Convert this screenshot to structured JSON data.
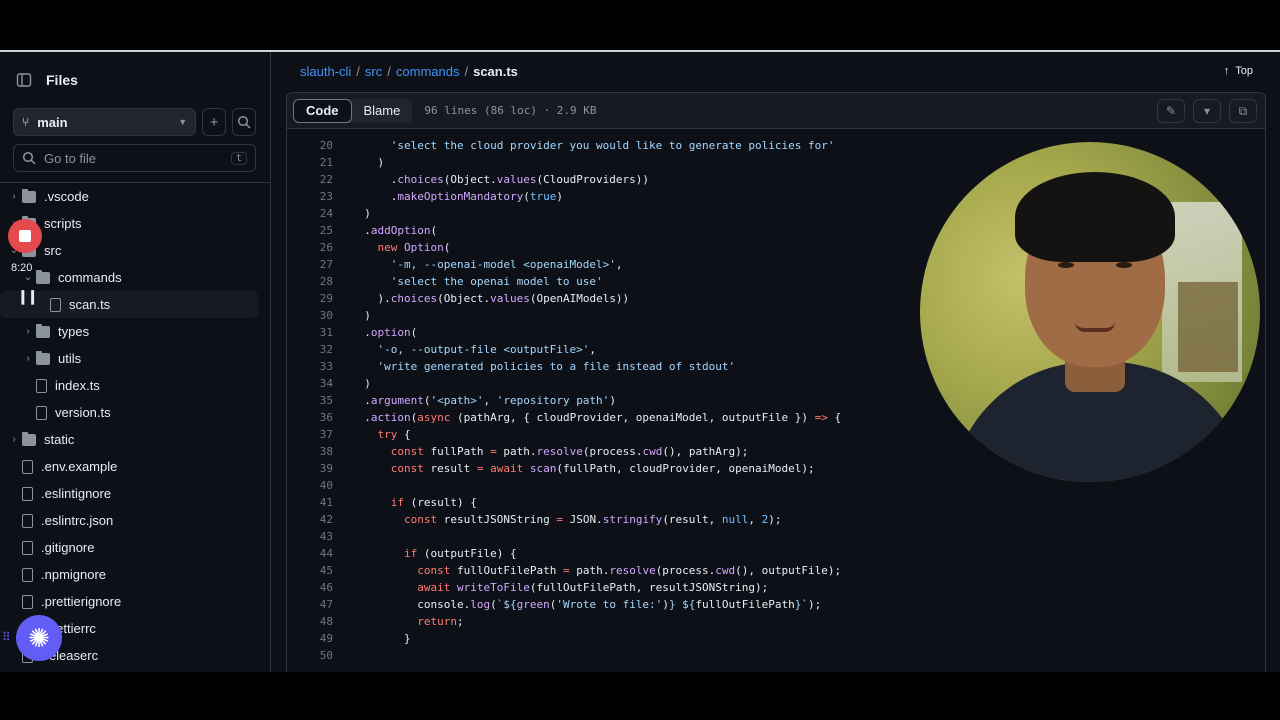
{
  "sidebar": {
    "title": "Files",
    "branch": "main",
    "search_placeholder": "Go to file",
    "search_shortcut": "t",
    "tree": [
      {
        "name": ".vscode",
        "kind": "folder",
        "chev": "›",
        "indent": 1
      },
      {
        "name": "scripts",
        "kind": "folder",
        "chev": "›",
        "indent": 1
      },
      {
        "name": "src",
        "kind": "folder",
        "chev": "⌄",
        "indent": 1
      },
      {
        "name": "commands",
        "kind": "folder",
        "chev": "⌄",
        "indent": 2
      },
      {
        "name": "scan.ts",
        "kind": "file",
        "chev": "",
        "indent": 3,
        "active": true
      },
      {
        "name": "types",
        "kind": "folder",
        "chev": "›",
        "indent": 2
      },
      {
        "name": "utils",
        "kind": "folder",
        "chev": "›",
        "indent": 2
      },
      {
        "name": "index.ts",
        "kind": "file",
        "chev": "",
        "indent": 2
      },
      {
        "name": "version.ts",
        "kind": "file",
        "chev": "",
        "indent": 2
      },
      {
        "name": "static",
        "kind": "folder",
        "chev": "›",
        "indent": 1
      },
      {
        "name": ".env.example",
        "kind": "file",
        "chev": "",
        "indent": 1
      },
      {
        "name": ".eslintignore",
        "kind": "file",
        "chev": "",
        "indent": 1
      },
      {
        "name": ".eslintrc.json",
        "kind": "file",
        "chev": "",
        "indent": 1
      },
      {
        "name": ".gitignore",
        "kind": "file",
        "chev": "",
        "indent": 1
      },
      {
        "name": ".npmignore",
        "kind": "file",
        "chev": "",
        "indent": 1
      },
      {
        "name": ".prettierignore",
        "kind": "file",
        "chev": "",
        "indent": 1
      },
      {
        "name": ".prettierrc",
        "kind": "file",
        "chev": "",
        "indent": 1
      },
      {
        "name": ".releaserc",
        "kind": "file",
        "chev": "",
        "indent": 1
      }
    ]
  },
  "recorder": {
    "time": "8:20"
  },
  "breadcrumb": {
    "repo": "slauth-cli",
    "dir1": "src",
    "dir2": "commands",
    "file": "scan.ts",
    "sep": "/"
  },
  "top_link": "Top",
  "file_header": {
    "code_tab": "Code",
    "blame_tab": "Blame",
    "meta": "96 lines (86 loc) · 2.9 KB"
  },
  "code_lines": [
    {
      "n": "20",
      "html": "      <span class='s'>'select the cloud provider you would like to generate policies for'</span>"
    },
    {
      "n": "21",
      "html": "    )"
    },
    {
      "n": "22",
      "html": "      .<span class='f'>choices</span>(Object.<span class='f'>values</span>(CloudProviders))"
    },
    {
      "n": "23",
      "html": "      .<span class='f'>makeOptionMandatory</span>(<span class='c'>true</span>)"
    },
    {
      "n": "24",
      "html": "  )"
    },
    {
      "n": "25",
      "html": "  .<span class='f'>addOption</span>("
    },
    {
      "n": "26",
      "html": "    <span class='k'>new</span> <span class='f'>Option</span>("
    },
    {
      "n": "27",
      "html": "      <span class='s'>'-m, --openai-model &lt;openaiModel&gt;'</span>,"
    },
    {
      "n": "28",
      "html": "      <span class='s'>'select the openai model to use'</span>"
    },
    {
      "n": "29",
      "html": "    ).<span class='f'>choices</span>(Object.<span class='f'>values</span>(OpenAIModels))"
    },
    {
      "n": "30",
      "html": "  )"
    },
    {
      "n": "31",
      "html": "  .<span class='f'>option</span>("
    },
    {
      "n": "32",
      "html": "    <span class='s'>'-o, --output-file &lt;outputFile&gt;'</span>,"
    },
    {
      "n": "33",
      "html": "    <span class='s'>'write generated policies to a file instead of stdout'</span>"
    },
    {
      "n": "34",
      "html": "  )"
    },
    {
      "n": "35",
      "html": "  .<span class='f'>argument</span>(<span class='s'>'&lt;path&gt;'</span>, <span class='s'>'repository path'</span>)"
    },
    {
      "n": "36",
      "html": "  .<span class='f'>action</span>(<span class='k'>async</span> (pathArg, { cloudProvider, openaiModel, outputFile }) <span class='k'>=&gt;</span> {"
    },
    {
      "n": "37",
      "html": "    <span class='k'>try</span> {"
    },
    {
      "n": "38",
      "html": "      <span class='k'>const</span> fullPath <span class='k'>=</span> path.<span class='f'>resolve</span>(process.<span class='f'>cwd</span>(), pathArg);"
    },
    {
      "n": "39",
      "html": "      <span class='k'>const</span> result <span class='k'>=</span> <span class='k'>await</span> <span class='f'>scan</span>(fullPath, cloudProvider, openaiModel);"
    },
    {
      "n": "40",
      "html": ""
    },
    {
      "n": "41",
      "html": "      <span class='k'>if</span> (result) {"
    },
    {
      "n": "42",
      "html": "        <span class='k'>const</span> resultJSONString <span class='k'>=</span> JSON.<span class='f'>stringify</span>(result, <span class='c'>null</span>, <span class='c'>2</span>);"
    },
    {
      "n": "43",
      "html": ""
    },
    {
      "n": "44",
      "html": "        <span class='k'>if</span> (outputFile) {"
    },
    {
      "n": "45",
      "html": "          <span class='k'>const</span> fullOutFilePath <span class='k'>=</span> path.<span class='f'>resolve</span>(process.<span class='f'>cwd</span>(), outputFile);"
    },
    {
      "n": "46",
      "html": "          <span class='k'>await</span> <span class='f'>writeToFile</span>(fullOutFilePath, resultJSONString);"
    },
    {
      "n": "47",
      "html": "          console.<span class='f'>log</span>(<span class='s'>`${</span><span class='f'>green</span>(<span class='s'>'Wrote to file:'</span>)<span class='s'>} ${</span>fullOutFilePath<span class='s'>}`</span>);"
    },
    {
      "n": "48",
      "html": "          <span class='k'>return</span>;"
    },
    {
      "n": "49",
      "html": "        }"
    },
    {
      "n": "50",
      "html": ""
    }
  ]
}
